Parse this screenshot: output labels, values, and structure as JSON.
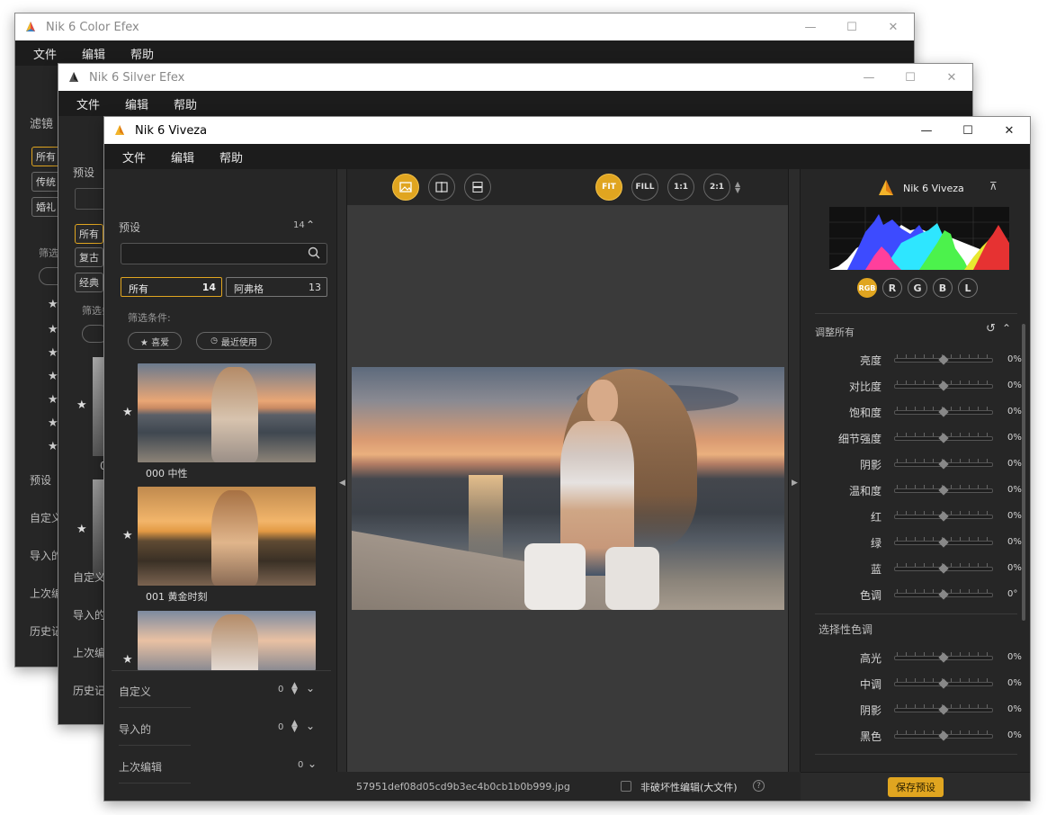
{
  "win_color": {
    "title": "Nik 6 Color Efex",
    "menu": [
      "文件",
      "编辑",
      "帮助"
    ],
    "filter_heading": "滤镜",
    "chips": [
      "所有",
      "传统",
      "婚礼"
    ],
    "filter_cond": "筛选",
    "side_labels": [
      "预设",
      "自定义",
      "导入的",
      "上次编辑",
      "历史记录"
    ]
  },
  "win_silver": {
    "title": "Nik 6 Silver Efex",
    "menu": [
      "文件",
      "编辑",
      "帮助"
    ],
    "preset_heading": "预设",
    "chips": [
      "所有",
      "复古",
      "经典"
    ],
    "filter_cond": "筛选条",
    "thumb_label": "0",
    "side_labels": [
      "自定义",
      "导入的",
      "上次编",
      "历史记"
    ]
  },
  "win_viveza": {
    "title": "Nik 6 Viveza",
    "menu": [
      "文件",
      "编辑",
      "帮助"
    ],
    "left": {
      "preset_heading": "预设",
      "preset_count": "14",
      "search_placeholder": "",
      "tab_all": "所有",
      "tab_all_count": "14",
      "tab_afog": "阿弗格",
      "tab_afog_count": "13",
      "filter_cond": "筛选条件:",
      "fav": "★ 喜爱",
      "recent": "最近使用",
      "presets": [
        {
          "label": "000 中性"
        },
        {
          "label": "001 黄金时刻"
        },
        {
          "label": ""
        }
      ],
      "sections": [
        {
          "label": "自定义",
          "count": "0"
        },
        {
          "label": "导入的",
          "count": "0"
        },
        {
          "label": "上次编辑",
          "count": "0"
        }
      ]
    },
    "toolbar": {
      "fit": "FIT",
      "fill": "FILL",
      "one": "1:1",
      "two": "2:1"
    },
    "bottom": {
      "filename": "57951def08d05cd9b3ec4b0cb1b0b999.jpg",
      "nondestructive": "非破坏性编辑(大文件)",
      "help": "?"
    },
    "right": {
      "brand": "Nik 6 Viveza",
      "channels": [
        "RGB",
        "R",
        "G",
        "B",
        "L"
      ],
      "adjust_all": "调整所有",
      "sliders": [
        {
          "label": "亮度",
          "value": "0%"
        },
        {
          "label": "对比度",
          "value": "0%"
        },
        {
          "label": "饱和度",
          "value": "0%"
        },
        {
          "label": "细节强度",
          "value": "0%"
        },
        {
          "label": "阴影",
          "value": "0%"
        },
        {
          "label": "温和度",
          "value": "0%"
        },
        {
          "label": "红",
          "value": "0%"
        },
        {
          "label": "绿",
          "value": "0%"
        },
        {
          "label": "蓝",
          "value": "0%"
        },
        {
          "label": "色调",
          "value": "0°"
        }
      ],
      "selective_heading": "选择性色调",
      "selective": [
        {
          "label": "高光",
          "value": "0%"
        },
        {
          "label": "中调",
          "value": "0%"
        },
        {
          "label": "阴影",
          "value": "0%"
        },
        {
          "label": "黑色",
          "value": "0%"
        }
      ],
      "save_preset": "保存预设"
    }
  },
  "colors": {
    "accent": "#e0a520",
    "panel": "#262626",
    "canvas": "#3a3a3a"
  }
}
